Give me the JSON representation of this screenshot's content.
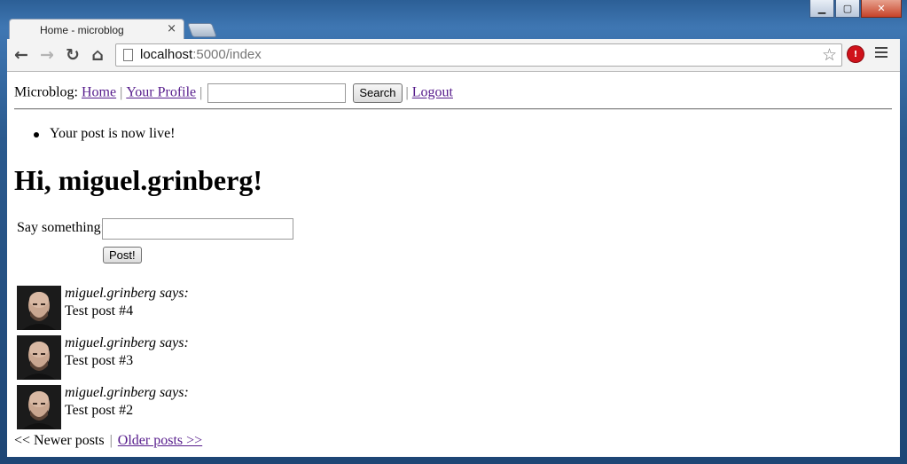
{
  "window": {
    "tab_title": "Home - microblog",
    "tab_close": "×",
    "controls": {
      "minimize": "▁",
      "maximize": "▢",
      "close": "✕"
    }
  },
  "toolbar": {
    "back": "←",
    "forward": "→",
    "reload": "↻",
    "home": "⌂",
    "url_host": "localhost",
    "url_rest": ":5000/index",
    "star": "☆",
    "extension_badge": "!"
  },
  "nav": {
    "brand": "Microblog:",
    "home": "Home",
    "separator": "|",
    "profile": "Your Profile",
    "search_value": "",
    "search_button": "Search",
    "logout": "Logout"
  },
  "flash_message": "Your post is now live!",
  "greeting": "Hi, miguel.grinberg!",
  "post_form": {
    "label": "Say something:",
    "value": "",
    "button": "Post!"
  },
  "posts": [
    {
      "author": "miguel.grinberg",
      "says": " says:",
      "body": "Test post #4"
    },
    {
      "author": "miguel.grinberg",
      "says": " says:",
      "body": "Test post #3"
    },
    {
      "author": "miguel.grinberg",
      "says": " says:",
      "body": "Test post #2"
    }
  ],
  "pagination": {
    "newer": "<< Newer posts",
    "separator": "|",
    "older": "Older posts >>"
  }
}
